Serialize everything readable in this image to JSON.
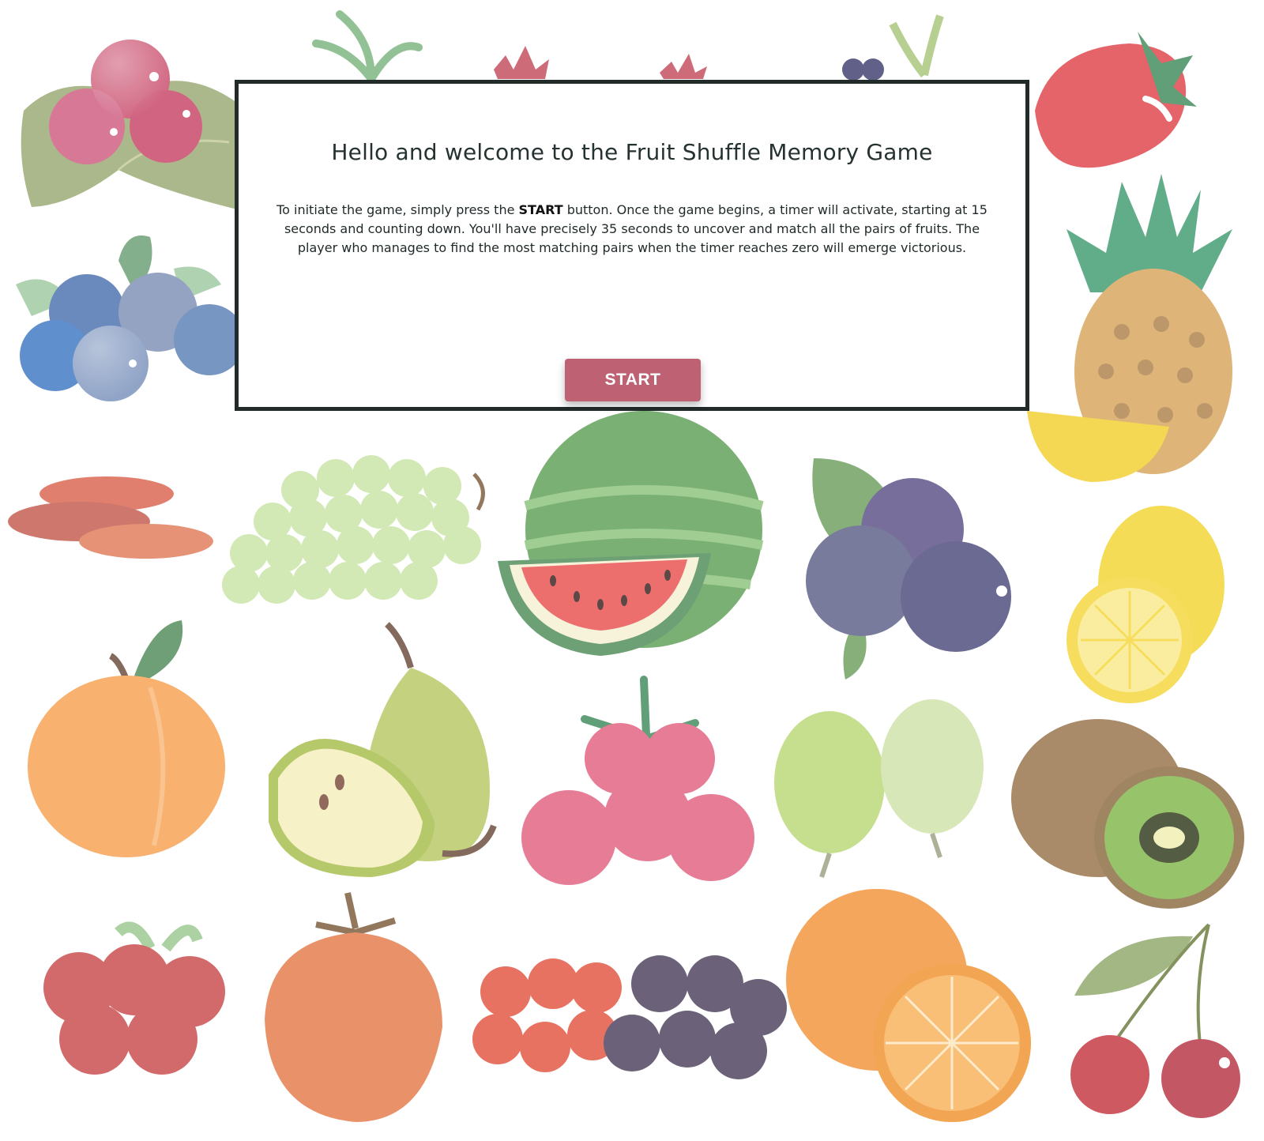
{
  "game": {
    "title": "Fruit Shuffle Memory Game"
  },
  "welcome_modal": {
    "heading": "Hello and welcome to the Fruit Shuffle Memory Game",
    "instructions": {
      "before_keyword": "To initiate the game, simply press the ",
      "keyword": "START",
      "after_keyword": " button. Once the game begins, a timer will activate, starting at 15 seconds and counting down. You'll have precisely 35 seconds to uncover and match all the pairs of fruits. The player who manages to find the most matching pairs when the timer reaches zero will emerge victorious."
    },
    "start_button_label": "START"
  },
  "board": {
    "cards": [
      {
        "fruit": "cranberries-icon"
      },
      {
        "fruit": "lychee-icon"
      },
      {
        "fruit": "pomegranate-icon"
      },
      {
        "fruit": "pomegranate-icon"
      },
      {
        "fruit": "blackberry-icon"
      },
      {
        "fruit": "strawberry-icon"
      },
      {
        "fruit": "blueberries-icon"
      },
      {
        "fruit": "pineapple-mango-icon"
      },
      {
        "fruit": "dried-apricots-icon"
      },
      {
        "fruit": "green-grapes-icon"
      },
      {
        "fruit": "watermelon-icon"
      },
      {
        "fruit": "plums-icon"
      },
      {
        "fruit": "lemon-icon"
      },
      {
        "fruit": "peach-icon"
      },
      {
        "fruit": "pear-icon"
      },
      {
        "fruit": "raspberries-icon"
      },
      {
        "fruit": "gooseberries-icon"
      },
      {
        "fruit": "kiwi-icon"
      },
      {
        "fruit": "red-currants-icon"
      },
      {
        "fruit": "persimmon-icon"
      },
      {
        "fruit": "cherries-and-black-currants-icon"
      },
      {
        "fruit": "orange-icon"
      },
      {
        "fruit": "cherries-icon"
      }
    ],
    "colors": {
      "modal_border": "#222a2a",
      "start_button": "#bd6173"
    }
  }
}
